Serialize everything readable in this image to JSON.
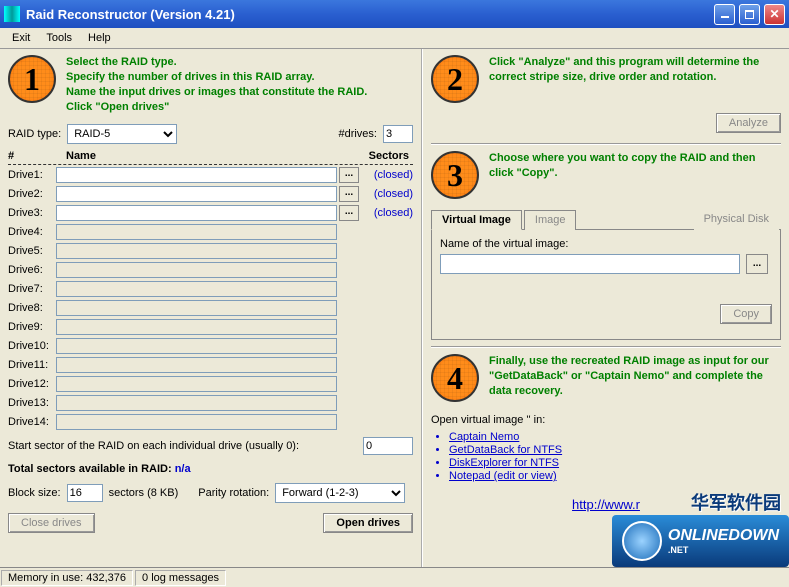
{
  "window": {
    "title": "Raid Reconstructor (Version 4.21)"
  },
  "menu": {
    "exit": "Exit",
    "tools": "Tools",
    "help": "Help"
  },
  "step1": {
    "num": "1",
    "l1": "Select the RAID type.",
    "l2": "Specify the number of drives in this RAID array.",
    "l3": "Name the input drives or images that constitute the RAID.",
    "l4": "Click \"Open drives\""
  },
  "raidtype_label": "RAID type:",
  "raidtype_value": "RAID-5",
  "ndrives_label": "#drives:",
  "ndrives_value": "3",
  "hdr": {
    "num": "#",
    "name": "Name",
    "sect": "Sectors"
  },
  "drives": [
    {
      "label": "Drive1:",
      "enabled": true,
      "status": "(closed)"
    },
    {
      "label": "Drive2:",
      "enabled": true,
      "status": "(closed)"
    },
    {
      "label": "Drive3:",
      "enabled": true,
      "status": "(closed)"
    },
    {
      "label": "Drive4:",
      "enabled": false,
      "status": ""
    },
    {
      "label": "Drive5:",
      "enabled": false,
      "status": ""
    },
    {
      "label": "Drive6:",
      "enabled": false,
      "status": ""
    },
    {
      "label": "Drive7:",
      "enabled": false,
      "status": ""
    },
    {
      "label": "Drive8:",
      "enabled": false,
      "status": ""
    },
    {
      "label": "Drive9:",
      "enabled": false,
      "status": ""
    },
    {
      "label": "Drive10:",
      "enabled": false,
      "status": ""
    },
    {
      "label": "Drive11:",
      "enabled": false,
      "status": ""
    },
    {
      "label": "Drive12:",
      "enabled": false,
      "status": ""
    },
    {
      "label": "Drive13:",
      "enabled": false,
      "status": ""
    },
    {
      "label": "Drive14:",
      "enabled": false,
      "status": ""
    }
  ],
  "startsector_label": "Start sector of the RAID on each individual drive (usually 0):",
  "startsector_value": "0",
  "total_label": "Total sectors available in RAID:",
  "total_value": "n/a",
  "blocksize_label": "Block size:",
  "blocksize_value": "16",
  "blocksize_suffix": "sectors (8 KB)",
  "parity_label": "Parity rotation:",
  "parity_value": "Forward (1-2-3)",
  "close_drives": "Close drives",
  "open_drives": "Open drives",
  "step2": {
    "num": "2",
    "text": "Click \"Analyze\" and this program will determine the correct stripe size, drive order and rotation."
  },
  "analyze": "Analyze",
  "step3": {
    "num": "3",
    "text": "Choose where you want to copy the RAID and then click \"Copy\"."
  },
  "tabs": {
    "vi": "Virtual Image",
    "img": "Image",
    "pd": "Physical Disk"
  },
  "vi_label": "Name of the virtual image:",
  "copy": "Copy",
  "step4": {
    "num": "4",
    "text": "Finally, use the recreated RAID image as input for our \"GetDataBack\" or \"Captain Nemo\" and complete the data recovery."
  },
  "openin_label": "Open virtual image '' in:",
  "links": {
    "cn": "Captain Nemo",
    "gdb": "GetDataBack for NTFS",
    "de": "DiskExplorer for NTFS",
    "np": "Notepad (edit or view)"
  },
  "url": "http://www.r",
  "status": {
    "mem": "Memory in use: 432,376",
    "log": "0 log messages"
  },
  "wm": {
    "top": "华军软件园",
    "brand": "ONLINEDOWN",
    "net": ".NET"
  }
}
